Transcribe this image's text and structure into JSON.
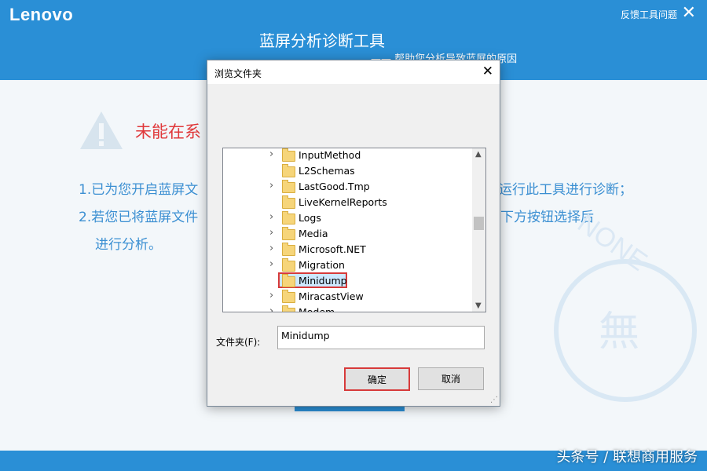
{
  "app": {
    "logo": "Lenovo",
    "feedback_label": "反馈工具问题",
    "close_glyph": "✕",
    "title": "蓝屏分析诊断工具",
    "subtitle": "—— 帮助您分析导致蓝屏的原因"
  },
  "main": {
    "error_text": "未能在系",
    "line1_left": "1.已为您开启蓝屏文",
    "line1_right": "运行此工具进行诊断；",
    "line2_left": "2.若您已将蓝屏文件",
    "line2_right": "击下方按钮选择后",
    "line3": "进行分析。",
    "watermark_none": "NONE",
    "watermark_mu": "無"
  },
  "dialog": {
    "title": "浏览文件夹",
    "close_glyph": "✕",
    "tree_items": [
      {
        "label": "InputMethod",
        "expandable": true
      },
      {
        "label": "L2Schemas",
        "expandable": false
      },
      {
        "label": "LastGood.Tmp",
        "expandable": true
      },
      {
        "label": "LiveKernelReports",
        "expandable": false
      },
      {
        "label": "Logs",
        "expandable": true
      },
      {
        "label": "Media",
        "expandable": true
      },
      {
        "label": "Microsoft.NET",
        "expandable": true
      },
      {
        "label": "Migration",
        "expandable": true
      },
      {
        "label": "Minidump",
        "expandable": false,
        "selected": true
      },
      {
        "label": "MiracastView",
        "expandable": true
      },
      {
        "label": "Modem...",
        "expandable": true
      }
    ],
    "folder_label": "文件夹(F):",
    "folder_value": "Minidump",
    "ok_label": "确定",
    "cancel_label": "取消"
  },
  "watermark": {
    "text": "头条号 / 联想商用服务"
  },
  "colors": {
    "header_blue": "#2a8fd6",
    "error_red": "#e0383a",
    "message_blue": "#3b8fd2",
    "highlight_red": "#d73a3a"
  }
}
